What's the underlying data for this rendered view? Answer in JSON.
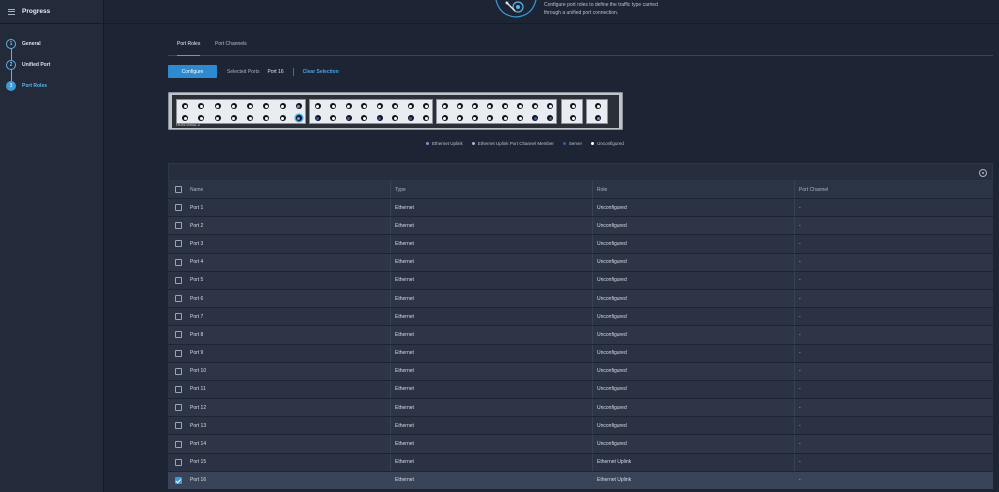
{
  "sidebar": {
    "title": "Progress",
    "steps": [
      {
        "num": "1",
        "label": "General"
      },
      {
        "num": "2",
        "label": "Unified Port"
      },
      {
        "num": "3",
        "label": "Port Roles"
      }
    ]
  },
  "header": {
    "description_line1": "Configure port roles to define the traffic type carried",
    "description_line2": "through a unified port connection."
  },
  "tabs": [
    {
      "label": "Port Roles",
      "active": true
    },
    {
      "label": "Port Channels",
      "active": false
    }
  ],
  "actions": {
    "configure_label": "Configure",
    "selected_ports_label": "Selected Ports",
    "selected_ports_value": "Port 16",
    "clear_selection_label": "Clear Selection"
  },
  "switch": {
    "model": "FI6454-MODEL-A"
  },
  "legend": [
    {
      "label": "Ethernet Uplink",
      "color": "#8d88d8"
    },
    {
      "label": "Ethernet Uplink Port Channel Member",
      "color": "#b9a8e8"
    },
    {
      "label": "Server",
      "color": "#3a56b8"
    },
    {
      "label": "Unconfigured",
      "color": "#ffffff"
    }
  ],
  "table": {
    "columns": [
      "Name",
      "Type",
      "Role",
      "Port Channel"
    ],
    "rows": [
      {
        "name": "Port 1",
        "type": "Ethernet",
        "role": "Unconfigured",
        "pc": "-",
        "checked": false
      },
      {
        "name": "Port 2",
        "type": "Ethernet",
        "role": "Unconfigured",
        "pc": "-",
        "checked": false
      },
      {
        "name": "Port 3",
        "type": "Ethernet",
        "role": "Unconfigured",
        "pc": "-",
        "checked": false
      },
      {
        "name": "Port 4",
        "type": "Ethernet",
        "role": "Unconfigured",
        "pc": "-",
        "checked": false
      },
      {
        "name": "Port 5",
        "type": "Ethernet",
        "role": "Unconfigured",
        "pc": "-",
        "checked": false
      },
      {
        "name": "Port 6",
        "type": "Ethernet",
        "role": "Unconfigured",
        "pc": "-",
        "checked": false
      },
      {
        "name": "Port 7",
        "type": "Ethernet",
        "role": "Unconfigured",
        "pc": "-",
        "checked": false
      },
      {
        "name": "Port 8",
        "type": "Ethernet",
        "role": "Unconfigured",
        "pc": "-",
        "checked": false
      },
      {
        "name": "Port 9",
        "type": "Ethernet",
        "role": "Unconfigured",
        "pc": "-",
        "checked": false
      },
      {
        "name": "Port 10",
        "type": "Ethernet",
        "role": "Unconfigured",
        "pc": "-",
        "checked": false
      },
      {
        "name": "Port 11",
        "type": "Ethernet",
        "role": "Unconfigured",
        "pc": "-",
        "checked": false
      },
      {
        "name": "Port 12",
        "type": "Ethernet",
        "role": "Unconfigured",
        "pc": "-",
        "checked": false
      },
      {
        "name": "Port 13",
        "type": "Ethernet",
        "role": "Unconfigured",
        "pc": "-",
        "checked": false
      },
      {
        "name": "Port 14",
        "type": "Ethernet",
        "role": "Unconfigured",
        "pc": "-",
        "checked": false
      },
      {
        "name": "Port 15",
        "type": "Ethernet",
        "role": "Ethernet Uplink",
        "pc": "-",
        "checked": false
      },
      {
        "name": "Port 16",
        "type": "Ethernet",
        "role": "Ethernet Uplink",
        "pc": "-",
        "checked": true
      }
    ]
  }
}
